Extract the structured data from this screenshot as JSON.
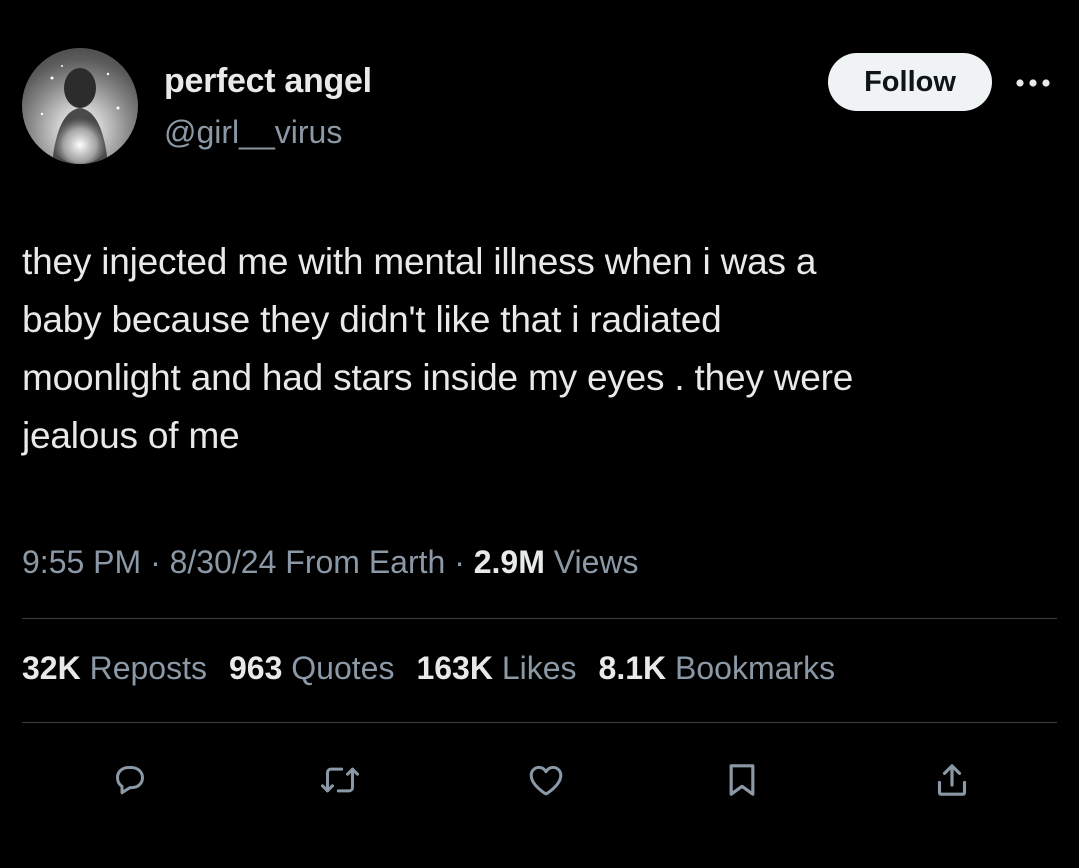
{
  "author": {
    "display_name": "perfect angel",
    "handle": "@girl__virus",
    "avatar_icon": "profile-photo"
  },
  "header": {
    "follow_label": "Follow",
    "more_icon": "more-horizontal-icon"
  },
  "tweet": {
    "text_lines": [
      "they injected me with mental illness when i was a",
      "baby because they didn't like that i radiated",
      "moonlight and had stars inside my eyes . they were",
      "jealous of me"
    ]
  },
  "meta": {
    "time": "9:55 PM",
    "sep1": "·",
    "date": "8/30/24",
    "source": "From Earth",
    "sep2": "·",
    "views_count": "2.9M",
    "views_label": "Views"
  },
  "stats": {
    "reposts_count": "32K",
    "reposts_label": "Reposts",
    "quotes_count": "963",
    "quotes_label": "Quotes",
    "likes_count": "163K",
    "likes_label": "Likes",
    "bookmarks_count": "8.1K",
    "bookmarks_label": "Bookmarks"
  },
  "actions": {
    "reply_icon": "reply-icon",
    "repost_icon": "repost-icon",
    "like_icon": "heart-icon",
    "bookmark_icon": "bookmark-icon",
    "share_icon": "share-icon"
  },
  "colors": {
    "background": "#000000",
    "primary_text": "#e7e9ea",
    "secondary_text": "#8b98a5",
    "follow_button_bg": "#eff3f4",
    "follow_button_text": "#0f1419",
    "divider": "#3a3f44"
  }
}
